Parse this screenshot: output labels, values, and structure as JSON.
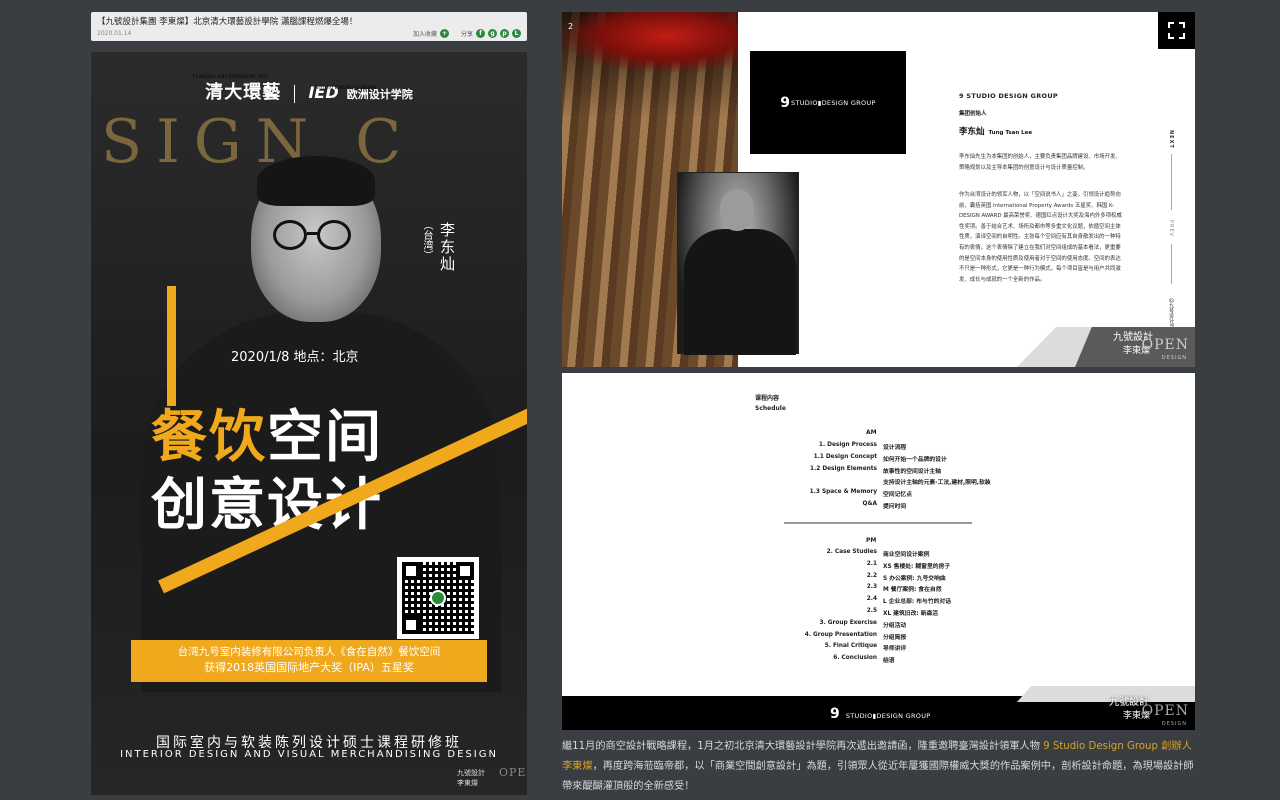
{
  "article": {
    "title": "【九號設計集團 李東燦】北京清大環藝設計學院 瀟腦課程燃爆全場！",
    "date": "2020.01.14",
    "bookmark_label": "加入收藏",
    "share_label": "分享"
  },
  "poster": {
    "logo_tsinghua": "清大環藝",
    "logo_tsinghua_sub": "TSINGDA ENVIRONMENT ART",
    "logo_ied": "IED",
    "logo_ied_cn": "欧洲设计学院",
    "logo_ied_sub": "ISTITUTO EUROPEO DI DESIGN",
    "background_word": "SIGN C",
    "speaker_name": "李东灿",
    "speaker_region": "（台湾）",
    "event_info": "2020/1/8    地点：北京",
    "title_line1_a": "餐饮",
    "title_line1_b": "空间",
    "title_line2": "创意设计",
    "award_line1": "台湾九号室内装修有限公司负责人《食在自然》餐饮空间",
    "award_line2": "获得2018英国国际地产大奖（IPA）五星奖",
    "program_cn": "国际室内与软装陈列设计硕士课程研修班",
    "program_en": "INTERIOR DESIGN AND VISUAL MERCHANDISING DESIGN",
    "brand_cn": "九號設計",
    "brand_person": "李東燦",
    "brand_open": "OPEN"
  },
  "profile": {
    "page_number": "2",
    "logo_number": "9",
    "logo_text": "STUDIO▮DESIGN GROUP",
    "company_name": "9 STUDIO DESIGN GROUP",
    "founder_label": "集团创始人",
    "founder_name": "李东灿",
    "founder_en": "Tung Tsan Lee",
    "bio_1": "李东灿先生为本集团的创始人，主要负责集团品牌建设、市场开发、策略规划以及主导本集团的创意设计与设计质量控制。",
    "bio_2": "作为台湾设计的领军人物，以「空间说书人」之姿，引领设计趋势向前，囊括英国 International Property Awards 五星奖、韩国 K-DESIGN AWARD 最高荣誉奖、德国红点设计大奖及海内外多项权威性奖项。善于结合艺术、场所及都市等多重文化议题，依循空间主体性质，演译空间的自明性。主张每个空间应有其自身散发出的一种特有的表情，这个表情除了建立在我们对空间组成的基本看法，更重要的是空间本身的使用性质及使用者对于空间的使用态度。空间的表达不只是一种形式，它更是一种行为模式，每个项目皆是与用户共同激发、成长与成就的一个全新的作品。",
    "nav_next": "NEXT",
    "nav_prev": "PREV",
    "wechat": "@九号设计9SDG",
    "brand_cn": "九號設計",
    "brand_person": "李東燦",
    "brand_open": "OPEN",
    "brand_design": "DESIGN"
  },
  "schedule": {
    "title_cn": "课程内容",
    "title_en": "Schedule",
    "am_label": "AM",
    "pm_label": "PM",
    "am_rows": [
      {
        "left": "1. Design Process",
        "right": "设计流程"
      },
      {
        "left": "1.1 Design Concept",
        "right": "如何开始一个品牌的设计"
      },
      {
        "left": "1.2 Design Elements",
        "right": "故事性的空间设计主轴"
      },
      {
        "left": "",
        "right": "支持设计主轴的元素-工法,建材,照明,软装"
      },
      {
        "left": "1.3 Space & Memory",
        "right": "空间记忆点"
      },
      {
        "left": "Q&A",
        "right": "提问时间"
      }
    ],
    "pm_rows": [
      {
        "left": "2. Case Studies",
        "right": "商业空间设计案例"
      },
      {
        "left": "2.1",
        "right": "XS 售楼处: 糊窗里的房子"
      },
      {
        "left": "2.2",
        "right": "S 办公案例: 九号交响曲"
      },
      {
        "left": "2.3",
        "right": "M 餐厅案例: 食在自然"
      },
      {
        "left": "2.4",
        "right": "L 企业总部: 布与竹的对话"
      },
      {
        "left": "2.5",
        "right": "XL 建筑旧改: 新森活"
      },
      {
        "left": "3. Group Exercise",
        "right": "分组活动"
      },
      {
        "left": "4. Group Presentation",
        "right": "分组简报"
      },
      {
        "left": "5. Final Critique",
        "right": "导师讲评"
      },
      {
        "left": "6. Conclusion",
        "right": "结语"
      }
    ],
    "footer_logo_number": "9",
    "footer_logo_text": "STUDIO▮DESIGN GROUP",
    "brand_cn": "九號設計",
    "brand_person": "李東燦",
    "brand_open": "OPEN",
    "brand_design": "DESIGN"
  },
  "caption": {
    "text_1": "繼11月的商空設計戰略課程，1月之初北京清大環藝設計學院再次遞出邀請函，隆重邀聘臺灣設計領軍人物 ",
    "highlight": "9 Studio Design Group 創辦人 李東燦",
    "text_2": "，再度跨海蒞臨帝都，以「商業空間創意設計」為題，引領眾人從近年屢獲國際權威大獎的作品案例中，剖析設計命題，為現場設計師帶來醍醐灌頂般的全新感受！"
  },
  "colors": {
    "accent_orange": "#f0a81c",
    "caption_gold": "#d4a32c",
    "page_bg": "#3a3e42"
  }
}
